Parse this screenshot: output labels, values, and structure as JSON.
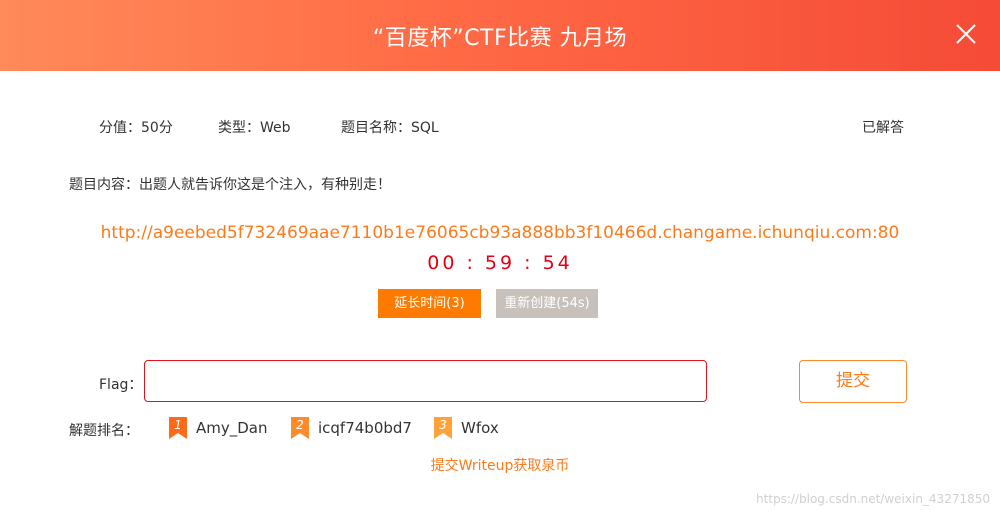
{
  "header": {
    "title": "“百度杯”CTF比赛 九月场"
  },
  "meta": {
    "score": "分值：50分",
    "type": "类型：Web",
    "name": "题目名称：SQL",
    "status": "已解答"
  },
  "content": {
    "label": "题目内容：",
    "text": "出题人就告诉你这是个注入，有种别走！"
  },
  "challenge": {
    "url": "http://a9eebed5f732469aae7110b1e76065cb93a888bb3f10466d.changame.ichunqiu.com:80",
    "timer": "00 : 59 : 54",
    "extend_label": "延长时间(3)",
    "recreate_label": "重新创建(54s)"
  },
  "flag": {
    "label": "Flag：",
    "value": "",
    "placeholder": "",
    "submit_label": "提交"
  },
  "ranking": {
    "label": "解题排名：",
    "items": [
      {
        "rank": "1",
        "name": "Amy_Dan"
      },
      {
        "rank": "2",
        "name": "icqf74b0bd7"
      },
      {
        "rank": "3",
        "name": "Wfox"
      }
    ]
  },
  "writeup": {
    "label": "提交Writeup获取泉币"
  },
  "watermark": "https://blog.csdn.net/weixin_43271850",
  "colors": {
    "accent": "#ff7a1a",
    "timer": "#e60012",
    "header_start": "#ff8a5a",
    "header_end": "#f54b37"
  },
  "icons": {
    "close": "close-icon",
    "rank": "ribbon-icon"
  }
}
